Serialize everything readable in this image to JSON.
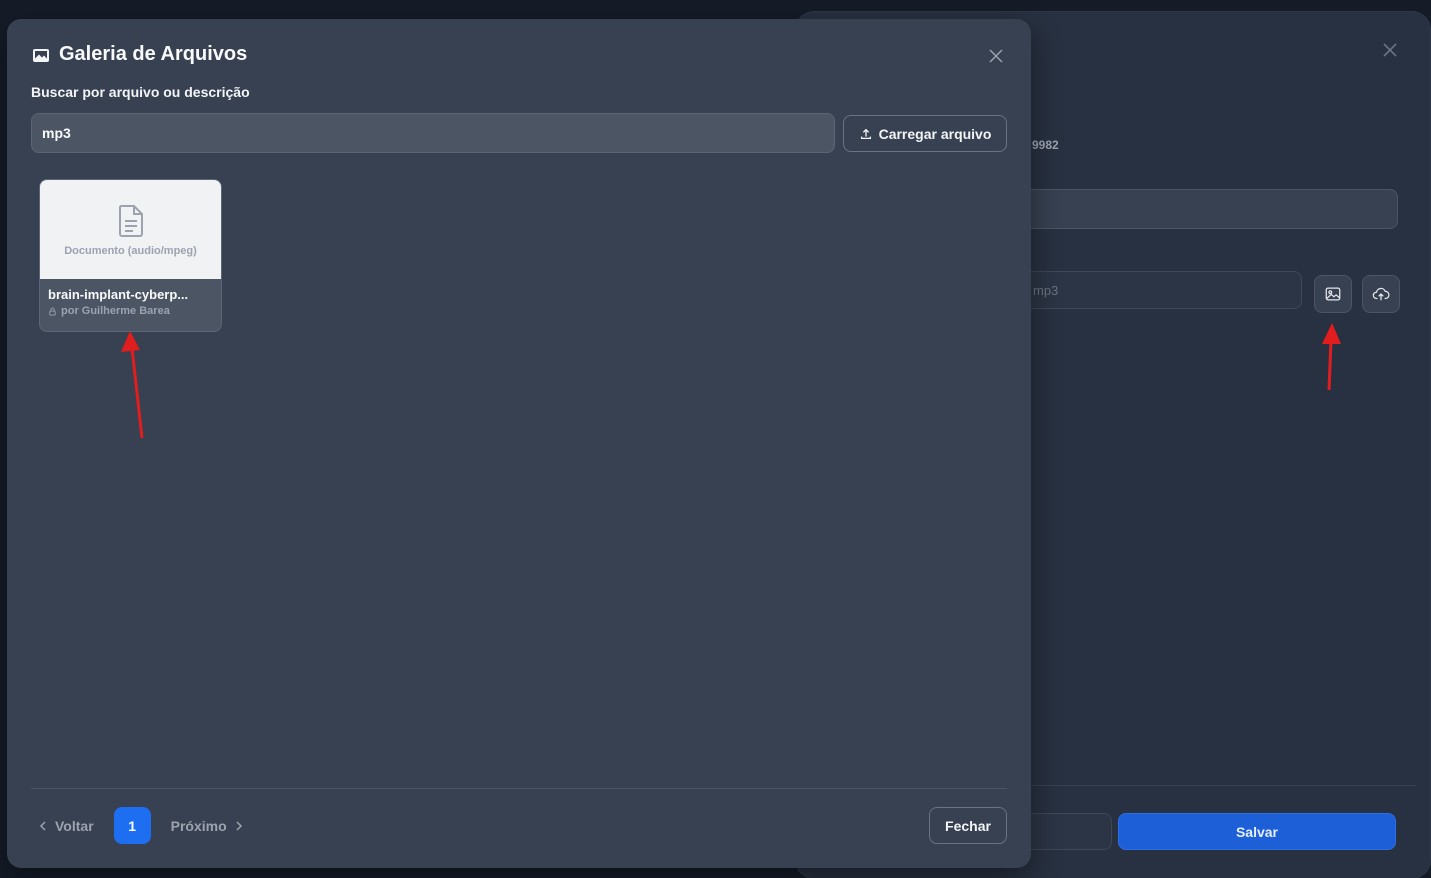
{
  "background_dialog": {
    "id_fragment": "9982",
    "input_value": "mp3",
    "gallery_icon": "image-icon",
    "upload_icon": "cloud-upload-icon",
    "save_label": "Salvar"
  },
  "gallery": {
    "title": "Galeria de Arquivos",
    "title_icon": "images-icon",
    "close_icon": "close-icon",
    "search_label": "Buscar por arquivo ou descrição",
    "search_value": "mp3",
    "upload_label": "Carregar arquivo",
    "files": [
      {
        "type_label": "Documento (audio/mpeg)",
        "name": "brain-implant-cyberp...",
        "owner": "por Guilherme Barea",
        "icon": "document-icon"
      }
    ],
    "pagination": {
      "prev_label": "Voltar",
      "current_page": "1",
      "next_label": "Próximo"
    },
    "close_label": "Fechar"
  },
  "annotations": {
    "arrow_color": "#e11d1d"
  }
}
